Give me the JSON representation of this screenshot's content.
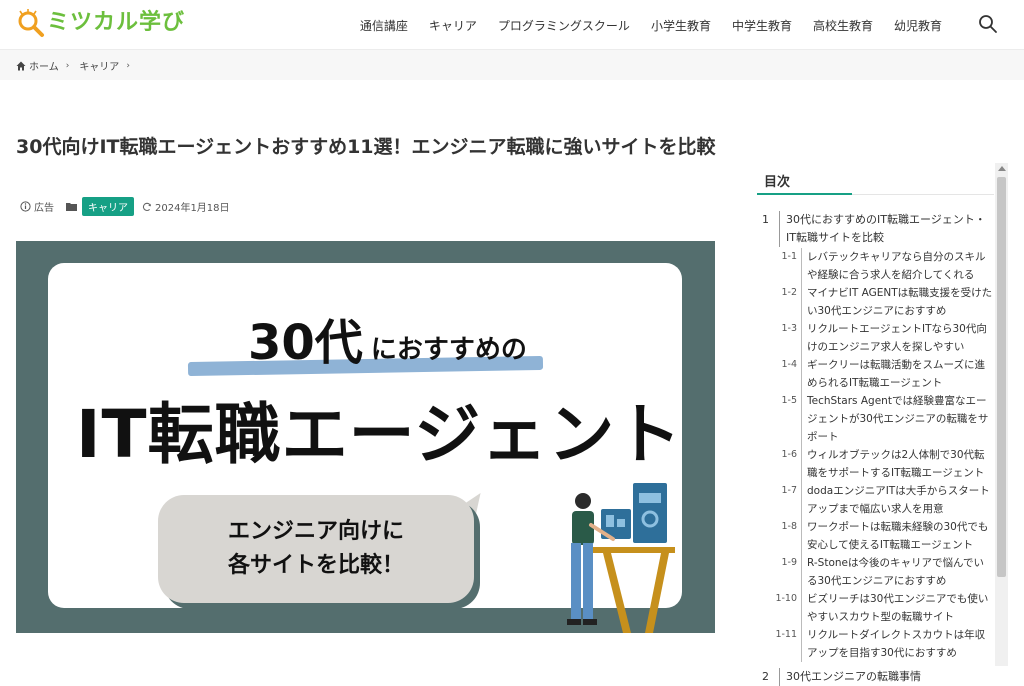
{
  "header": {
    "logo_text": "ミツカル学び",
    "nav": [
      "通信講座",
      "キャリア",
      "プログラミングスクール",
      "小学生教育",
      "中学生教育",
      "高校生教育",
      "幼児教育"
    ]
  },
  "breadcrumb": {
    "home": "ホーム",
    "category": "キャリア"
  },
  "article": {
    "title": "30代向けIT転職エージェントおすすめ11選！エンジニア転職に強いサイトを比較",
    "ad_label": "広告",
    "category_badge": "キャリア",
    "date": "2024年1月18日"
  },
  "hero": {
    "line_30": "30代",
    "line_ni": "におすすめの",
    "big": "IT転職エージェント",
    "bubble_line1": "エンジニア向けに",
    "bubble_line2": "各サイトを比較！"
  },
  "toc": {
    "heading": "目次",
    "items": [
      {
        "num": "1",
        "text": "30代におすすめのIT転職エージェント・IT転職サイトを比較",
        "level": 1
      },
      {
        "num": "1-1",
        "text": "レバテックキャリアなら自分のスキルや経験に合う求人を紹介してくれる",
        "level": 2
      },
      {
        "num": "1-2",
        "text": "マイナビIT AGENTは転職支援を受けたい30代エンジニアにおすすめ",
        "level": 2
      },
      {
        "num": "1-3",
        "text": "リクルートエージェントITなら30代向けのエンジニア求人を探しやすい",
        "level": 2
      },
      {
        "num": "1-4",
        "text": "ギークリーは転職活動をスムーズに進められるIT転職エージェント",
        "level": 2
      },
      {
        "num": "1-5",
        "text": "TechStars Agentでは経験豊富なエージェントが30代エンジニアの転職をサポート",
        "level": 2
      },
      {
        "num": "1-6",
        "text": "ウィルオブテックは2人体制で30代転職をサポートするIT転職エージェント",
        "level": 2
      },
      {
        "num": "1-7",
        "text": "dodaエンジニアITは大手からスタートアップまで幅広い求人を用意",
        "level": 2
      },
      {
        "num": "1-8",
        "text": "ワークポートは転職未経験の30代でも安心して使えるIT転職エージェント",
        "level": 2
      },
      {
        "num": "1-9",
        "text": "R-Stoneは今後のキャリアで悩んでいる30代エンジニアにおすすめ",
        "level": 2
      },
      {
        "num": "1-10",
        "text": "ビズリーチは30代エンジニアでも使いやすいスカウト型の転職サイト",
        "level": 2
      },
      {
        "num": "1-11",
        "text": "リクルートダイレクトスカウトは年収アップを目指す30代におすすめ",
        "level": 2
      },
      {
        "num": "2",
        "text": "30代エンジニアの転職事情",
        "level": 1
      }
    ]
  },
  "colors": {
    "brand_green": "#6cbf3d",
    "accent_teal": "#16a085",
    "hero_bg": "#546e6e"
  }
}
